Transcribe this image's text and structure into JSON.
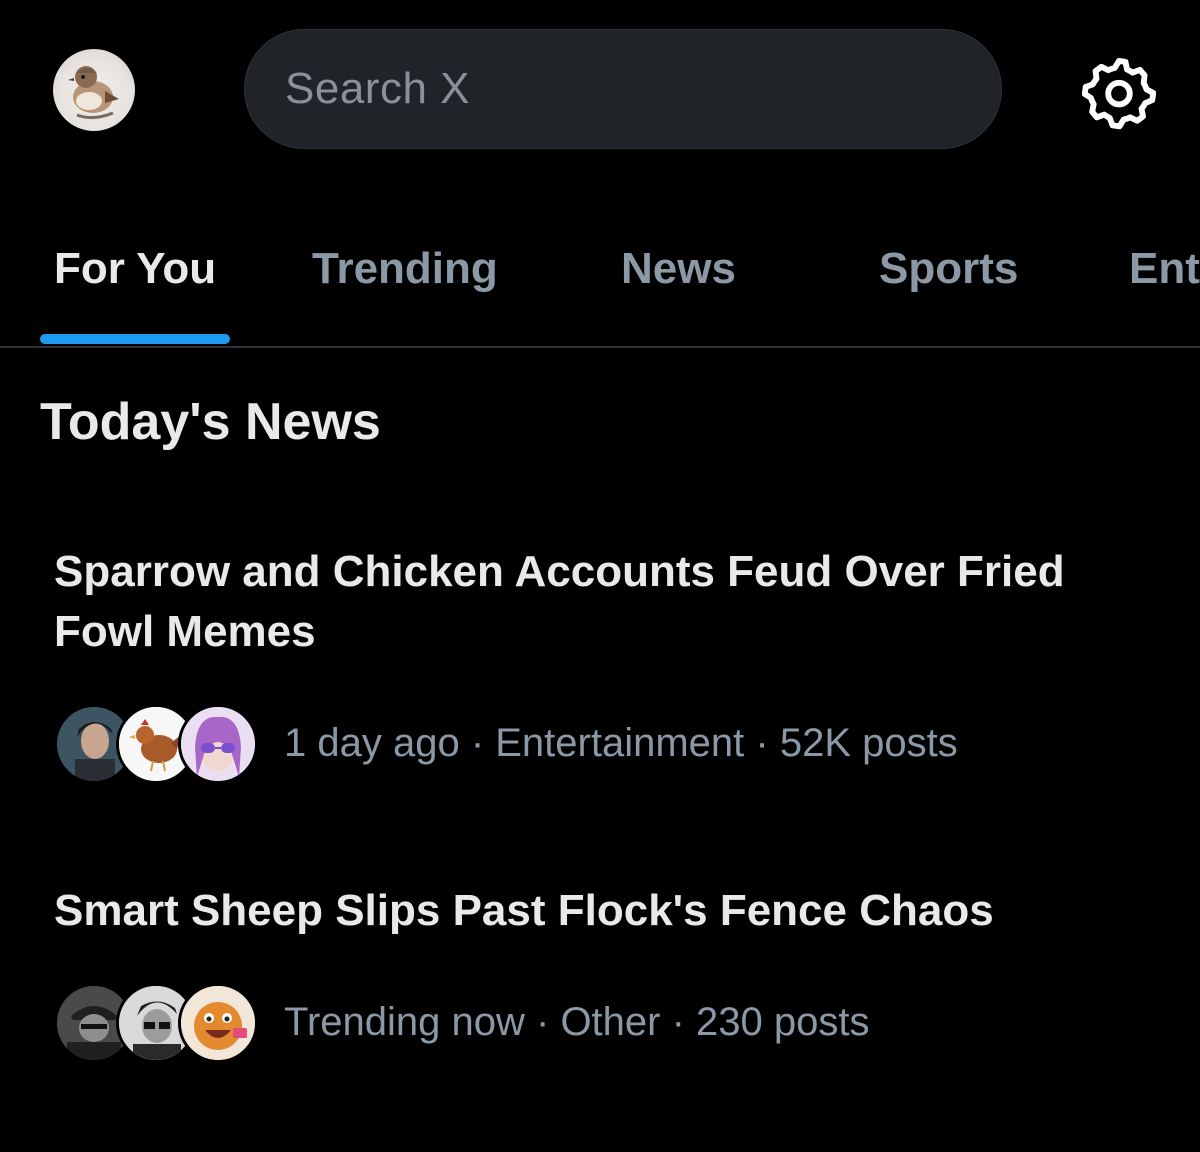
{
  "search": {
    "placeholder": "Search X"
  },
  "icons": {
    "avatar": "sparrow-avatar",
    "settings": "gear-icon"
  },
  "tabs": [
    {
      "label": "For You",
      "active": true
    },
    {
      "label": "Trending",
      "active": false
    },
    {
      "label": "News",
      "active": false
    },
    {
      "label": "Sports",
      "active": false
    },
    {
      "label": "Ent",
      "active": false
    }
  ],
  "section": {
    "title": "Today's News"
  },
  "stories": [
    {
      "headline": "Sparrow and Chicken Accounts Feud Over Fried Fowl Memes",
      "time": "1 day ago",
      "category": "Entertainment",
      "posts": "52K posts"
    },
    {
      "headline": "Smart Sheep Slips Past Flock's Fence Chaos",
      "time": "Trending now",
      "category": "Other",
      "posts": "230 posts"
    }
  ],
  "colors": {
    "background": "#000000",
    "accent": "#1d9bf0",
    "primary_text": "#e7e9ea",
    "secondary_text": "#8b98a5",
    "search_bg": "#202327"
  }
}
